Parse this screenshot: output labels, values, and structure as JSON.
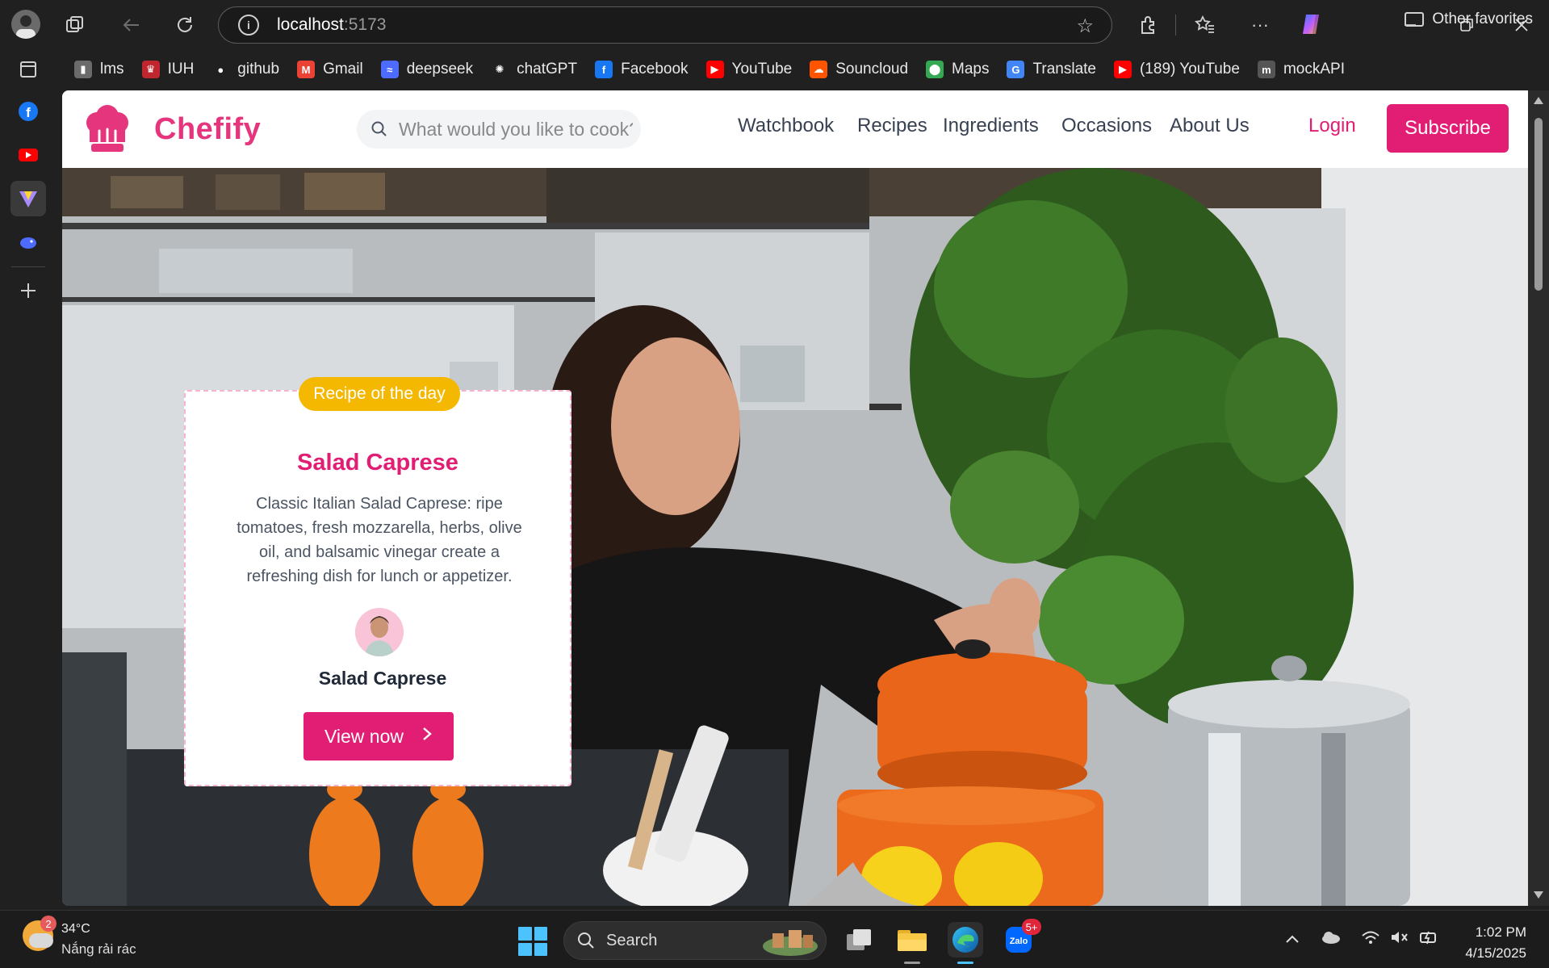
{
  "browser": {
    "url_host": "localhost",
    "url_port": ":5173",
    "bookmarks": [
      {
        "label": "lms",
        "icon": "lms-icon",
        "color": "#6b6b6b"
      },
      {
        "label": "IUH",
        "icon": "iuh-icon",
        "color": "#c0262d"
      },
      {
        "label": "github",
        "icon": "github-icon",
        "color": "#ffffff"
      },
      {
        "label": "Gmail",
        "icon": "gmail-icon",
        "color": "#ea4335"
      },
      {
        "label": "deepseek",
        "icon": "deepseek-icon",
        "color": "#4d6bfe"
      },
      {
        "label": "chatGPT",
        "icon": "chatgpt-icon",
        "color": "#ffffff"
      },
      {
        "label": "Facebook",
        "icon": "facebook-icon",
        "color": "#1877f2"
      },
      {
        "label": "YouTube",
        "icon": "youtube-icon",
        "color": "#ff0000"
      },
      {
        "label": "Souncloud",
        "icon": "soundcloud-icon",
        "color": "#ff5500"
      },
      {
        "label": "Maps",
        "icon": "maps-icon",
        "color": "#34a853"
      },
      {
        "label": "Translate",
        "icon": "translate-icon",
        "color": "#4285f4"
      },
      {
        "label": "(189) YouTube",
        "icon": "youtube-icon",
        "color": "#ff0000"
      },
      {
        "label": "mockAPI",
        "icon": "mockapi-icon",
        "color": "#555555"
      }
    ],
    "other_favorites": "Other favorites"
  },
  "site": {
    "brand": "Chefify",
    "brand_color": "#e5357d",
    "search_placeholder": "What would you like to cook?",
    "nav": [
      "Watchbook",
      "Recipes",
      "Ingredients",
      "Occasions",
      "About Us"
    ],
    "login": "Login",
    "subscribe": "Subscribe"
  },
  "card": {
    "badge": "Recipe of the day",
    "title": "Salad Caprese",
    "description": "Classic Italian Salad Caprese: ripe tomatoes, fresh mozzarella, herbs, olive oil, and balsamic vinegar create a refreshing dish for lunch or appetizer.",
    "author": "Salad Caprese",
    "cta": "View now"
  },
  "taskbar": {
    "weather_badge": "2",
    "temperature": "34°C",
    "condition": "Nắng rải rác",
    "search_label": "Search",
    "zalo_badge": "5+",
    "time": "1:02 PM",
    "date": "4/15/2025"
  }
}
